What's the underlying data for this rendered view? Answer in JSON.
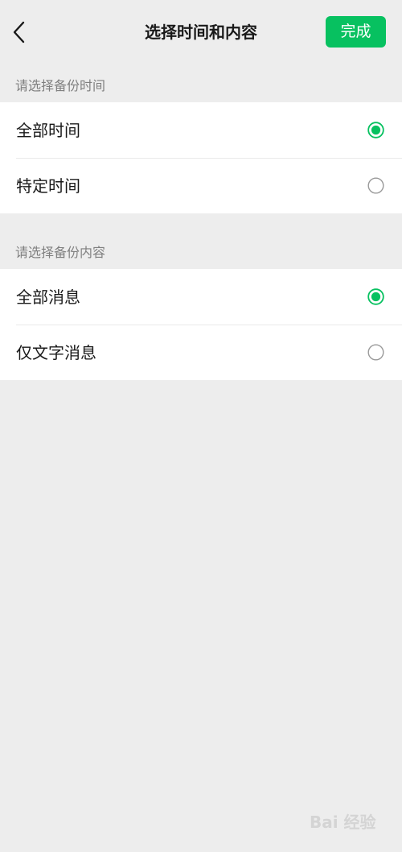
{
  "header": {
    "title": "选择时间和内容",
    "done_label": "完成"
  },
  "time_section": {
    "label": "请选择备份时间",
    "options": [
      {
        "label": "全部时间",
        "selected": true
      },
      {
        "label": "特定时间",
        "selected": false
      }
    ]
  },
  "content_section": {
    "label": "请选择备份内容",
    "options": [
      {
        "label": "全部消息",
        "selected": true
      },
      {
        "label": "仅文字消息",
        "selected": false
      }
    ]
  },
  "colors": {
    "accent": "#07c160",
    "background": "#ededed"
  },
  "watermark": "Bai 经验"
}
